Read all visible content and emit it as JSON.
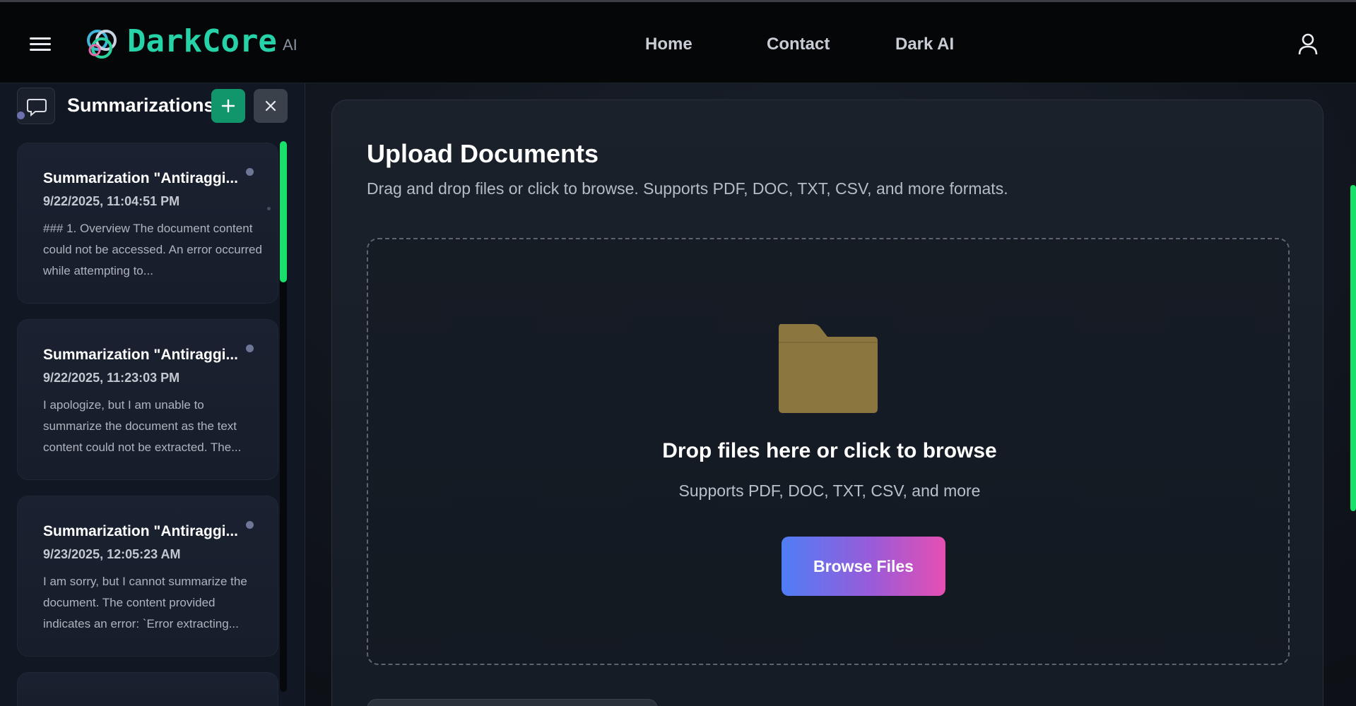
{
  "header": {
    "brand": "DarkCore",
    "brand_sub": "AI",
    "nav": [
      "Home",
      "Contact",
      "Dark AI"
    ]
  },
  "sidebar": {
    "title": "Summarizations",
    "cards": [
      {
        "title": "Summarization \"Antiraggi...",
        "date": "9/22/2025, 11:04:51 PM",
        "text": "### 1. Overview The document content could not be accessed. An error occurred while attempting to..."
      },
      {
        "title": "Summarization \"Antiraggi...",
        "date": "9/22/2025, 11:23:03 PM",
        "text": "I apologize, but I am unable to summarize the document as the text content could not be extracted. The..."
      },
      {
        "title": "Summarization \"Antiraggi...",
        "date": "9/23/2025, 12:05:23 AM",
        "text": "I am sorry, but I cannot summarize the document. The content provided indicates an error: `Error extracting..."
      }
    ]
  },
  "main": {
    "title": "Upload Documents",
    "subtitle": "Drag and drop files or click to browse. Supports PDF, DOC, TXT, CSV, and more formats.",
    "dropzone": {
      "title": "Drop files here or click to browse",
      "subtitle": "Supports PDF, DOC, TXT, CSV, and more",
      "button": "Browse Files"
    }
  },
  "colors": {
    "accent_green": "#18e06b",
    "brand_teal": "#26d3a8",
    "add_button": "#11966b",
    "folder": "#8c7640",
    "button_gradient": [
      "#4f7df5",
      "#9a5bd9",
      "#e54fb2"
    ]
  },
  "icons": [
    "hamburger-icon",
    "logo-icon",
    "user-icon",
    "chat-icon",
    "plus-icon",
    "close-icon",
    "folder-icon"
  ]
}
